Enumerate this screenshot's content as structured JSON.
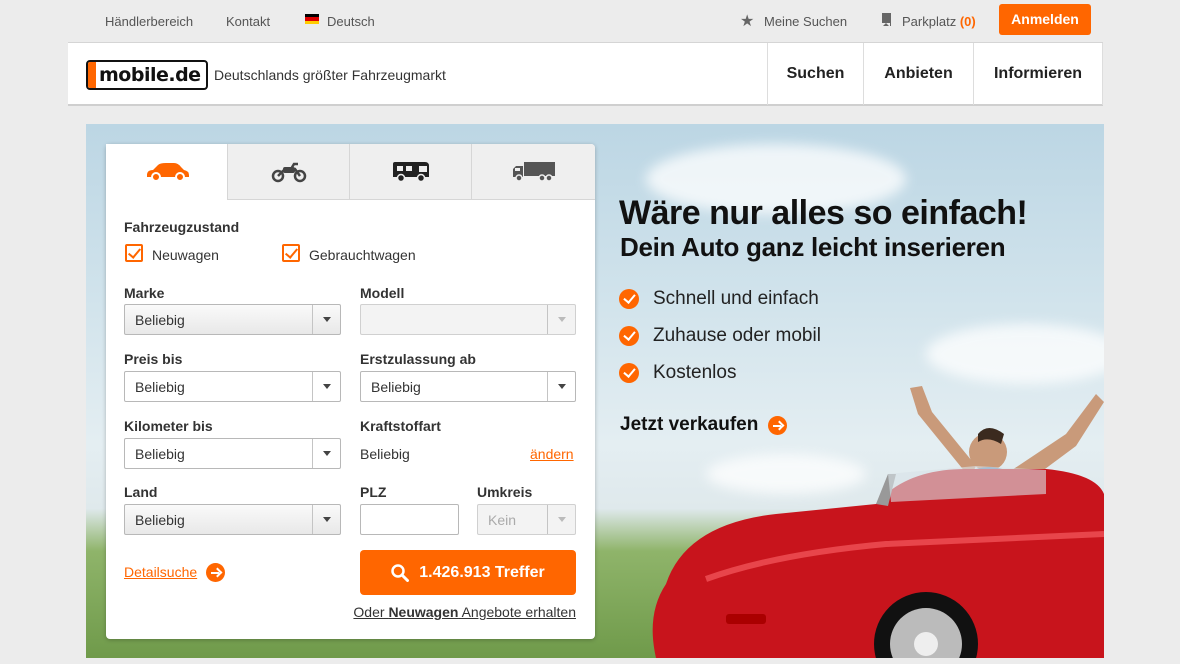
{
  "topbar": {
    "dealer": "Händlerbereich",
    "contact": "Kontakt",
    "language": "Deutsch",
    "my_searches": "Meine Suchen",
    "parking_label": "Parkplatz",
    "parking_count": "(0)",
    "login": "Anmelden"
  },
  "header": {
    "logo": "mobile.de",
    "tagline": "Deutschlands größter Fahrzeugmarkt",
    "nav": [
      "Suchen",
      "Anbieten",
      "Informieren"
    ]
  },
  "search": {
    "tabs": [
      "car-icon",
      "motorbike-icon",
      "motorhome-icon",
      "truck-icon"
    ],
    "condition_label": "Fahrzeugzustand",
    "new_label": "Neuwagen",
    "used_label": "Gebrauchtwagen",
    "make_label": "Marke",
    "make_value": "Beliebig",
    "model_label": "Modell",
    "model_value": "",
    "price_label": "Preis bis",
    "price_value": "Beliebig",
    "reg_label": "Erstzulassung ab",
    "reg_value": "Beliebig",
    "km_label": "Kilometer bis",
    "km_value": "Beliebig",
    "fuel_label": "Kraftstoffart",
    "fuel_value": "Beliebig",
    "fuel_change": "ändern",
    "country_label": "Land",
    "country_value": "Beliebig",
    "zip_label": "PLZ",
    "zip_value": "",
    "radius_label": "Umkreis",
    "radius_value": "Kein",
    "detail_search": "Detailsuche",
    "results_button": "1.426.913 Treffer",
    "new_offers_prefix": "Oder ",
    "new_offers_bold": "Neuwagen",
    "new_offers_suffix": " Angebote erhalten"
  },
  "hero": {
    "title": "Wäre nur alles so einfach!",
    "subtitle": "Dein Auto ganz leicht inserieren",
    "bullets": [
      "Schnell und einfach",
      "Zuhause oder mobil",
      "Kostenlos"
    ],
    "cta": "Jetzt verkaufen"
  },
  "colors": {
    "accent": "#ff6600",
    "car_red": "#c8141c"
  }
}
